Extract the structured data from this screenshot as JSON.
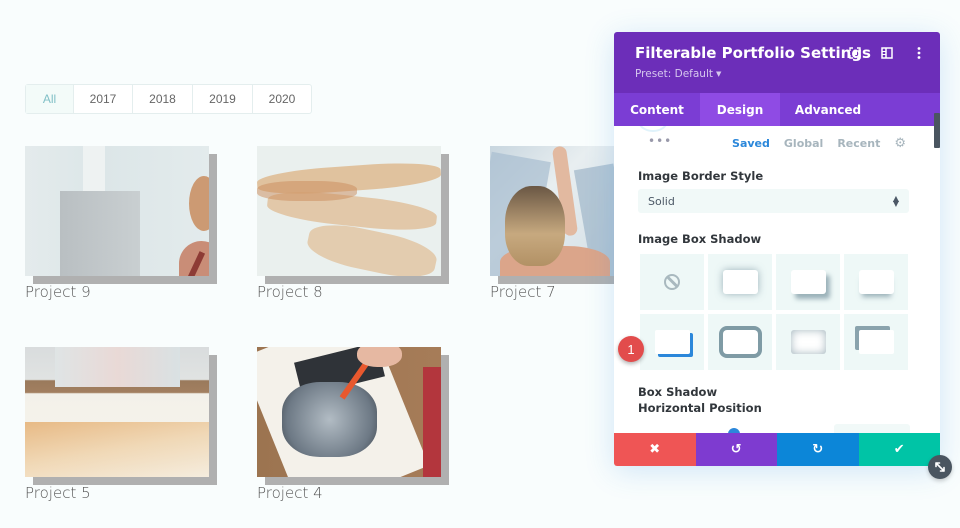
{
  "filters": [
    "All",
    "2017",
    "2018",
    "2019",
    "2020"
  ],
  "active_filter": "All",
  "portfolio": [
    {
      "title": "Project 9"
    },
    {
      "title": "Project 8"
    },
    {
      "title": "Project 7"
    },
    {
      "title": "Project 5"
    },
    {
      "title": "Project 4"
    }
  ],
  "panel": {
    "title": "Filterable Portfolio Settings",
    "preset": "Preset: Default",
    "header_icons": [
      "focus-mode-icon",
      "split-view-icon",
      "more-options-icon"
    ],
    "tabs": [
      "Content",
      "Design",
      "Advanced"
    ],
    "active_tab": "Design",
    "preset_row": {
      "saved": "Saved",
      "global": "Global",
      "recent": "Recent"
    },
    "border_style": {
      "label": "Image Border Style",
      "value": "Solid"
    },
    "box_shadow": {
      "label": "Image Box Shadow",
      "options": [
        "none",
        "shadow-all",
        "shadow-bottom-right",
        "shadow-bottom",
        "shadow-corner-blue",
        "shadow-border",
        "shadow-inset",
        "shadow-top-left"
      ]
    },
    "badge": "1",
    "horizontal_position_label": "Box Shadow Horizontal Position",
    "footer": {
      "cancel": "✖",
      "undo": "↺",
      "redo": "↻",
      "save": "✔"
    }
  },
  "colors": {
    "header": "#6c2eb9",
    "tabs": "#7b3dd4",
    "tab_active": "#8f4be4",
    "cancel": "#ef5555",
    "undo": "#7e3bd0",
    "redo": "#0c86d8",
    "save": "#00c4a6",
    "accent": "#2b87da"
  }
}
